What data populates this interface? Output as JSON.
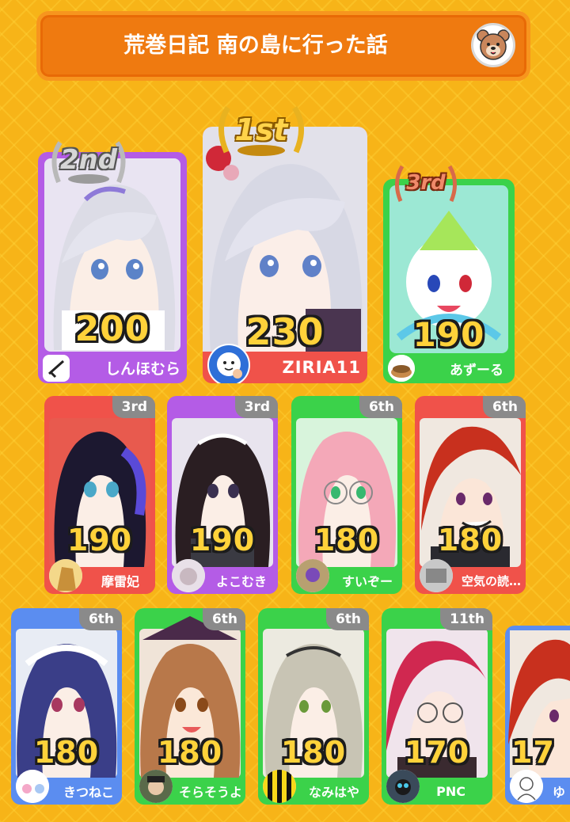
{
  "header": {
    "title": "荒巻日記 南の島に行った話",
    "icon": "bear-icon"
  },
  "podium": [
    {
      "rank_label": "2nd",
      "score": "200",
      "name": "しんほむら",
      "medal": "silver"
    },
    {
      "rank_label": "1st",
      "score": "230",
      "name": "ZIRIA11",
      "medal": "gold"
    },
    {
      "rank_label": "3rd",
      "score": "190",
      "name": "あずーる",
      "medal": "bronze"
    }
  ],
  "ranks": [
    {
      "rank_label": "3rd",
      "score": "190",
      "name": "摩雷妃"
    },
    {
      "rank_label": "3rd",
      "score": "190",
      "name": "よこむき"
    },
    {
      "rank_label": "6th",
      "score": "180",
      "name": "すいぞー"
    },
    {
      "rank_label": "6th",
      "score": "180",
      "name": "空気の読…"
    },
    {
      "rank_label": "6th",
      "score": "180",
      "name": "きつねこ"
    },
    {
      "rank_label": "6th",
      "score": "180",
      "name": "そらそうよ"
    },
    {
      "rank_label": "6th",
      "score": "180",
      "name": "なみはや"
    },
    {
      "rank_label": "11th",
      "score": "170",
      "name": "PNC"
    },
    {
      "rank_label": "",
      "score": "17",
      "name": "ゆ"
    }
  ],
  "colors": {
    "background": "#f7b418",
    "header": "#ef7a10",
    "purple": "#b45ce6",
    "red": "#f0524a",
    "green": "#3bd24a",
    "blue": "#5b8df0",
    "score_fill": "#ffd23a"
  }
}
